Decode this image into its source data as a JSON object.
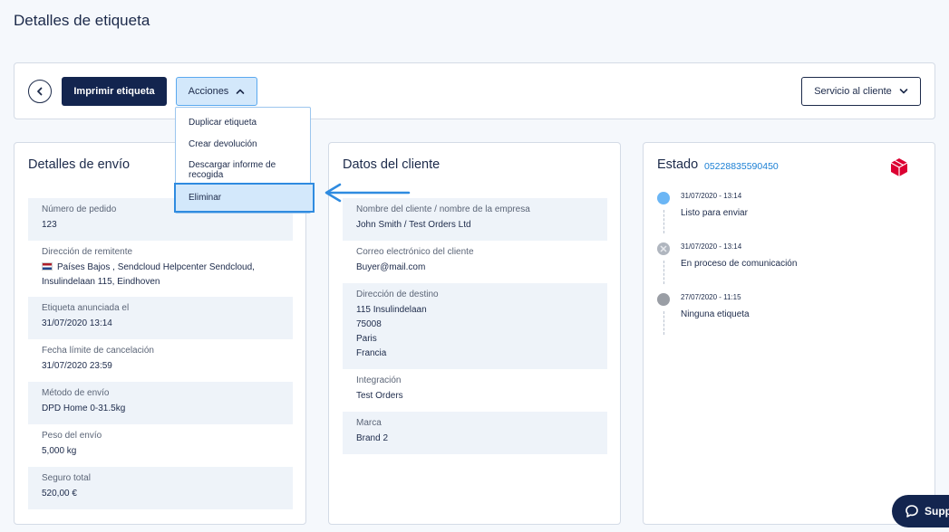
{
  "page": {
    "title": "Detalles de etiqueta"
  },
  "toolbar": {
    "print_label": "Imprimir etiqueta",
    "actions_label": "Acciones",
    "service_label": "Servicio al cliente"
  },
  "actions_menu": {
    "items": [
      "Duplicar etiqueta",
      "Crear devolución",
      "Descargar informe de recogida",
      "Eliminar"
    ],
    "selected": "Eliminar"
  },
  "shipping": {
    "title": "Detalles de envío",
    "fields": [
      {
        "label": "Número de pedido",
        "value": "123"
      },
      {
        "label": "Dirección de remitente",
        "value": "Países Bajos , Sendcloud Helpcenter Sendcloud, Insulindelaan 115, Eindhoven"
      },
      {
        "label": "Etiqueta anunciada el",
        "value": "31/07/2020 13:14"
      },
      {
        "label": "Fecha límite de cancelación",
        "value": "31/07/2020 23:59"
      },
      {
        "label": "Método de envío",
        "value": "DPD Home 0-31.5kg"
      },
      {
        "label": "Peso del envío",
        "value": "5,000 kg"
      },
      {
        "label": "Seguro total",
        "value": "520,00 €"
      }
    ]
  },
  "client": {
    "title": "Datos del cliente",
    "fields": [
      {
        "label": "Nombre del cliente / nombre de la empresa",
        "value": "John Smith / Test Orders Ltd"
      },
      {
        "label": "Correo electrónico del cliente",
        "value": "Buyer@mail.com"
      },
      {
        "label": "Dirección de destino",
        "lines": [
          "115 Insulindelaan",
          "75008",
          "Paris",
          "Francia"
        ]
      },
      {
        "label": "Integración",
        "value": "Test Orders"
      },
      {
        "label": "Marca",
        "value": "Brand 2"
      }
    ]
  },
  "status": {
    "title": "Estado",
    "tracking_number": "05228835590450",
    "carrier_icon": "dpd-cube-icon",
    "events": [
      {
        "date": "31/07/2020 - 13:14",
        "label": "Listo para enviar",
        "color": "#6bb6f5"
      },
      {
        "date": "31/07/2020 - 13:14",
        "label": "En proceso de comunicación",
        "color": "#b0b6bf"
      },
      {
        "date": "27/07/2020 - 11:15",
        "label": "Ninguna etiqueta",
        "color": "#9a9ea5"
      }
    ]
  },
  "support": {
    "label": "Supp"
  },
  "colors": {
    "primary": "#13254f",
    "accent": "#2f8be0",
    "dpd_red": "#dc0032"
  }
}
